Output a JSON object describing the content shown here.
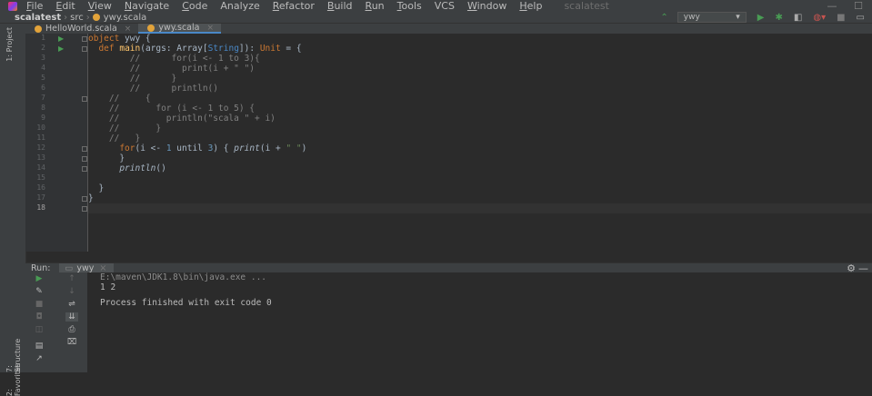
{
  "menu": [
    "File",
    "Edit",
    "View",
    "Navigate",
    "Code",
    "Analyze",
    "Refactor",
    "Build",
    "Run",
    "Tools",
    "VCS",
    "Window",
    "Help"
  ],
  "window_title": "scalatest",
  "breadcrumb": {
    "project": "scalatest",
    "folder": "src",
    "file": "ywy.scala"
  },
  "run_config": "ywy",
  "side_labels": {
    "project": "1: Project",
    "structure": "7: Structure",
    "favorites": "2: Favorites"
  },
  "tabs": [
    {
      "label": "HelloWorld.scala",
      "active": false
    },
    {
      "label": "ywy.scala",
      "active": true
    }
  ],
  "line_numbers": [
    "1",
    "2",
    "3",
    "4",
    "5",
    "6",
    "7",
    "8",
    "9",
    "10",
    "11",
    "12",
    "13",
    "14",
    "15",
    "16",
    "17",
    "18"
  ],
  "code": {
    "l1": {
      "kw": "object",
      "rest": " ywy {"
    },
    "l2": {
      "ind": "  ",
      "kw": "def",
      "fn": " main",
      "a": "(args: Array[",
      "ty": "String",
      "b": "]): ",
      "kw2": "Unit",
      "c": " = {"
    },
    "l3": "        //      for(i <- 1 to 3){",
    "l4": "        //        print(i + \" \")",
    "l5": "        //      }",
    "l6": "        //      println()",
    "l7": "    //     {",
    "l8": "    //       for (i <- 1 to 5) {",
    "l9": "    //         println(\"scala \" + i)",
    "l10": "    //       }",
    "l11": "    //   }",
    "l12": {
      "ind": "      ",
      "kw": "for",
      "a": "(i <- ",
      "n1": "1",
      "b": " until ",
      "n2": "3",
      "c": ") { ",
      "it": "print",
      "d": "(i + ",
      "s": "\" \"",
      "e": ")"
    },
    "l13": "      }",
    "l14": {
      "ind": "      ",
      "it": "println",
      "rest": "()"
    },
    "l15": "",
    "l16": "  }",
    "l17": "}",
    "l18": ""
  },
  "run": {
    "label": "Run:",
    "tab": "ywy",
    "console": [
      "E:\\maven\\JDK1.8\\bin\\java.exe ...",
      "1 2",
      "",
      "Process finished with exit code 0"
    ]
  },
  "colors": {
    "keyword": "#cc7832",
    "function": "#ffc66d",
    "type": "#4a88c7",
    "number": "#6897bb",
    "string": "#6a8759",
    "comment": "#808080",
    "run_green": "#499c54"
  }
}
